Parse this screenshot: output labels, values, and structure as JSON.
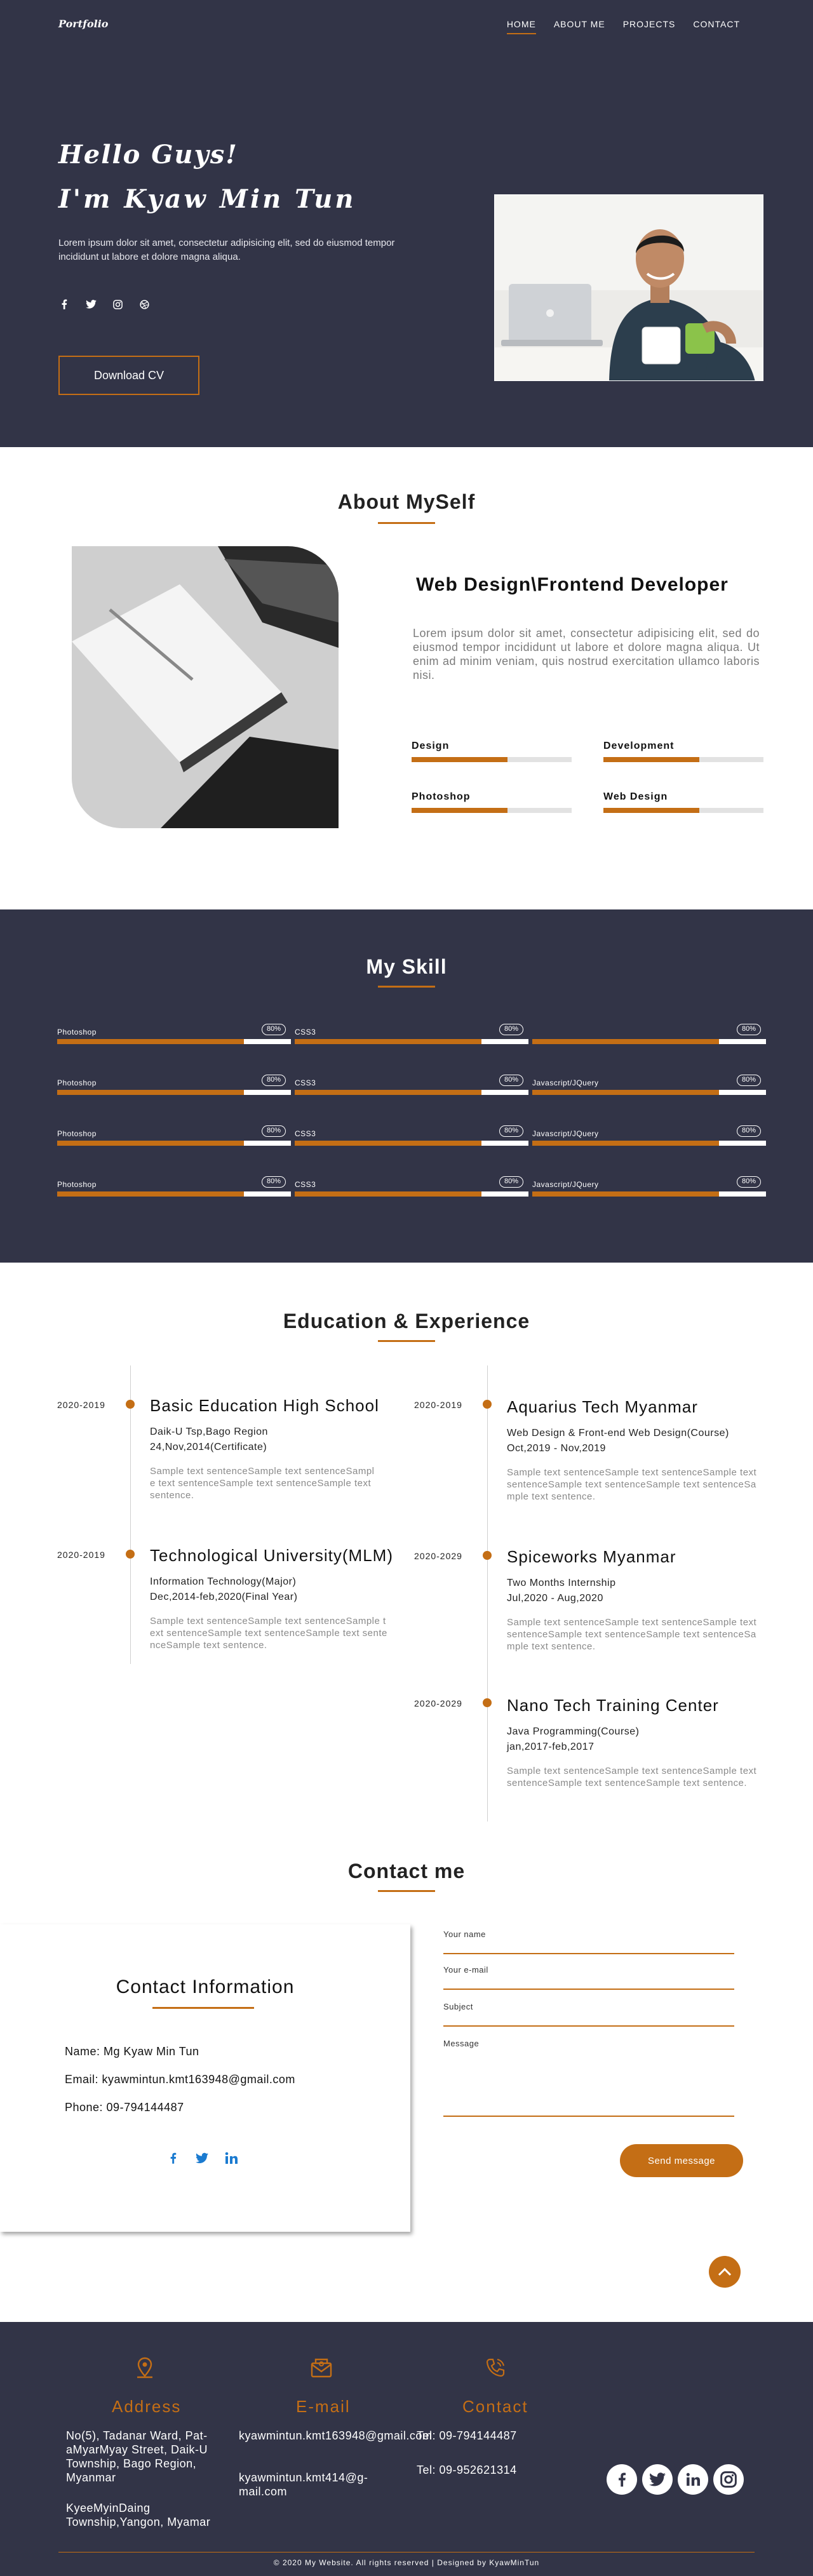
{
  "brand": {
    "logo": "Portfolio",
    "accent": "#c46e15",
    "dark_bg": "#323447"
  },
  "nav": {
    "items": [
      {
        "label": "HOME",
        "active": true
      },
      {
        "label": "ABOUT ME"
      },
      {
        "label": "PROJECTS"
      },
      {
        "label": "CONTACT"
      }
    ]
  },
  "hero": {
    "greeting": "Hello Guys!",
    "name": "I'm Kyaw Min Tun",
    "intro": "Lorem ipsum dolor sit amet, consectetur adipisicing elit, sed do eiusmod tempor incididunt ut labore et dolore magna aliqua.",
    "socials": [
      "facebook-icon",
      "twitter-icon",
      "instagram-icon",
      "dribbble-icon"
    ],
    "cta_label": "Download CV"
  },
  "about": {
    "title": "About MySelf",
    "role": "Web Design\\Frontend Developer",
    "text": "Lorem ipsum dolor sit amet, consectetur adipisicing elit, sed do eiusmod tempor incididunt ut labore et dolore magna aliqua. Ut enim ad minim veniam, quis nostrud exercitation ullamco laboris nisi.",
    "bars": [
      {
        "label": "Design",
        "level": 0.6
      },
      {
        "label": "Development",
        "level": 0.6
      },
      {
        "label": "Photoshop",
        "level": 0.6
      },
      {
        "label": "Web Design",
        "level": 0.6
      }
    ]
  },
  "skills": {
    "title": "My Skill",
    "rows": [
      [
        {
          "label": "Photoshop",
          "pct": "80%",
          "level": 0.8
        },
        {
          "label": "CSS3",
          "pct": "80%",
          "level": 0.8
        },
        {
          "label": "",
          "pct": "80%",
          "level": 0.8
        }
      ],
      [
        {
          "label": "Photoshop",
          "pct": "80%",
          "level": 0.8
        },
        {
          "label": "CSS3",
          "pct": "80%",
          "level": 0.8
        },
        {
          "label": "Javascript/JQuery",
          "pct": "80%",
          "level": 0.8
        }
      ],
      [
        {
          "label": "Photoshop",
          "pct": "80%",
          "level": 0.8
        },
        {
          "label": "CSS3",
          "pct": "80%",
          "level": 0.8
        },
        {
          "label": "Javascript/JQuery",
          "pct": "80%",
          "level": 0.8
        }
      ],
      [
        {
          "label": "Photoshop",
          "pct": "80%",
          "level": 0.8
        },
        {
          "label": "CSS3",
          "pct": "80%",
          "level": 0.8
        },
        {
          "label": "Javascript/JQuery",
          "pct": "80%",
          "level": 0.8
        }
      ]
    ]
  },
  "education": {
    "title": "Education & Experience",
    "left": [
      {
        "date": "2020-2019",
        "title": "Basic Education High School",
        "sub1": "Daik-U Tsp,Bago Region",
        "sub2": "24,Nov,2014(Certificate)",
        "desc": "Sample text sentenceSample text sentenceSample text sentenceSample text sentenceSample text sentence."
      },
      {
        "date": "2020-2019",
        "title": "Technological University(MLM)",
        "sub1": "Information Technology(Major)",
        "sub2": "Dec,2014-feb,2020(Final Year)",
        "desc": "Sample text sentenceSample text sentenceSample text sentenceSample text sentenceSample text sentenceSample text sentence."
      }
    ],
    "right": [
      {
        "date": "2020-2019",
        "title": "Aquarius Tech Myanmar",
        "sub1": "Web Design & Front-end Web Design(Course)",
        "sub2": "Oct,2019 - Nov,2019",
        "desc": "Sample text sentenceSample text sentenceSample text sentenceSample text sentenceSample text sentenceSample text sentence."
      },
      {
        "date": "2020-2029",
        "title": "Spiceworks Myanmar",
        "sub1": "Two Months Internship",
        "sub2": "Jul,2020 - Aug,2020",
        "desc": "Sample text sentenceSample text sentenceSample text sentenceSample text sentenceSample text sentenceSample text sentence."
      },
      {
        "date": "2020-2029",
        "title": "Nano Tech Training Center",
        "sub1": "Java Programming(Course)",
        "sub2": "jan,2017-feb,2017",
        "desc": "Sample text sentenceSample text sentenceSample text sentenceSample text sentenceSample text sentence."
      }
    ]
  },
  "contact": {
    "title": "Contact me",
    "info_title": "Contact Information",
    "name": "Name: Mg Kyaw Min Tun",
    "email": "Email: kyawmintun.kmt163948@gmail.com",
    "phone": "Phone: 09-794144487",
    "socials": [
      "facebook-icon",
      "twitter-icon",
      "linkedin-icon"
    ],
    "form": {
      "name_label": "Your name",
      "email_label": "Your e-mail",
      "subject_label": "Subject",
      "message_label": "Message",
      "send_label": "Send message"
    }
  },
  "footer": {
    "address": {
      "head": "Address",
      "line1": "No(5), Tadanar Ward, Pat-aMyarMyay Street, Daik-U Township, Bago Region, Myanmar",
      "line2": "KyeeMyinDaing Township,Yangon, Myamar"
    },
    "email": {
      "head": "E-mail",
      "line1": "kyawmintun.kmt163948@gmail.com",
      "line2": "kyawmintun.kmt414@g-mail.com"
    },
    "contact": {
      "head": "Contact",
      "line1": "Tel: 09-794144487",
      "line2": "Tel: 09-952621314"
    },
    "socials": [
      "facebook-icon",
      "twitter-icon",
      "linkedin-icon",
      "instagram-icon"
    ],
    "copyright": "© 2020 My Website. All rights reserved | Designed by KyawMinTun"
  }
}
